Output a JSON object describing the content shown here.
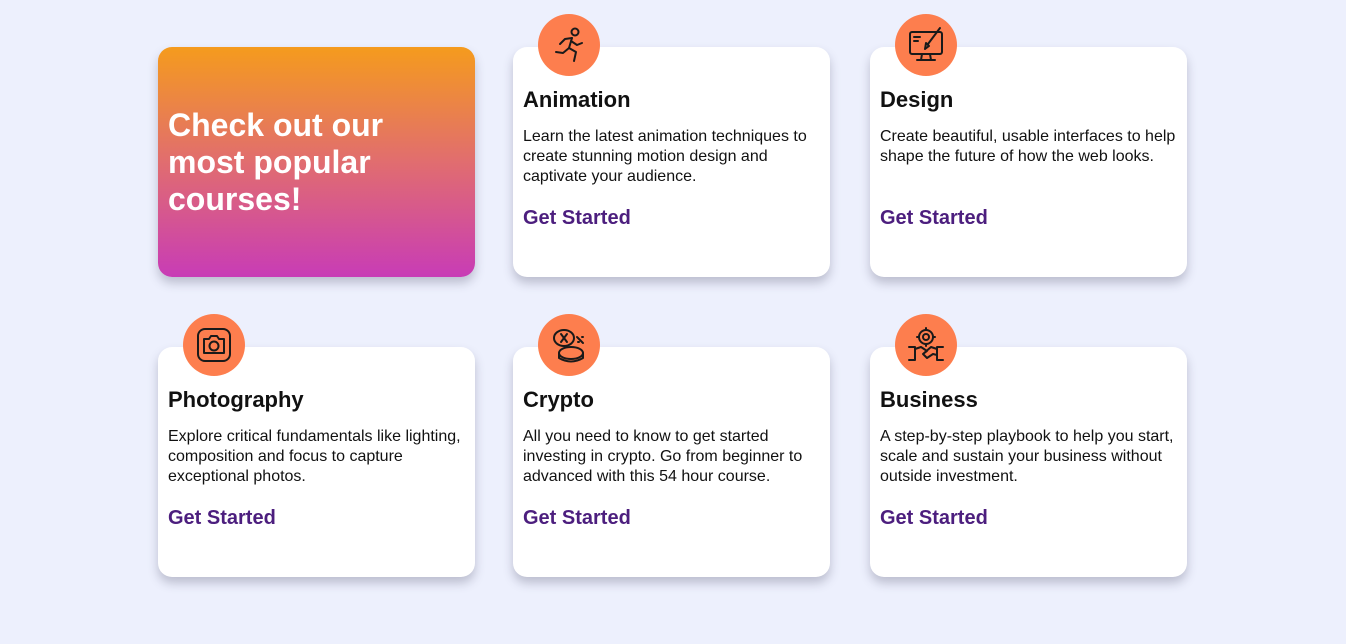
{
  "hero": {
    "title": "Check out our most popular courses!"
  },
  "courses": [
    {
      "title": "Animation",
      "icon": "running-person-icon",
      "description": "Learn the latest animation techniques to create stunning motion design and captivate your audience.",
      "cta": "Get Started"
    },
    {
      "title": "Design",
      "icon": "monitor-design-icon",
      "description": "Create beautiful, usable interfaces to help shape the future of how the web looks.",
      "cta": "Get Started"
    },
    {
      "title": "Photography",
      "icon": "camera-icon",
      "description": "Explore critical fundamentals like lighting, composition and focus to capture exceptional photos.",
      "cta": "Get Started"
    },
    {
      "title": "Crypto",
      "icon": "crypto-coins-icon",
      "description": "All you need to know to get started investing in crypto. Go from beginner to advanced with this 54 hour course.",
      "cta": "Get Started"
    },
    {
      "title": "Business",
      "icon": "business-handshake-icon",
      "description": "A step-by-step playbook to help you start, scale and sustain your business without outside investment.",
      "cta": "Get Started"
    }
  ],
  "colors": {
    "background": "#edf0fd",
    "badge": "#fd7e4e",
    "link": "#4c1e7e",
    "gradient_top": "#f59b1d",
    "gradient_bottom": "#c83cb6"
  }
}
